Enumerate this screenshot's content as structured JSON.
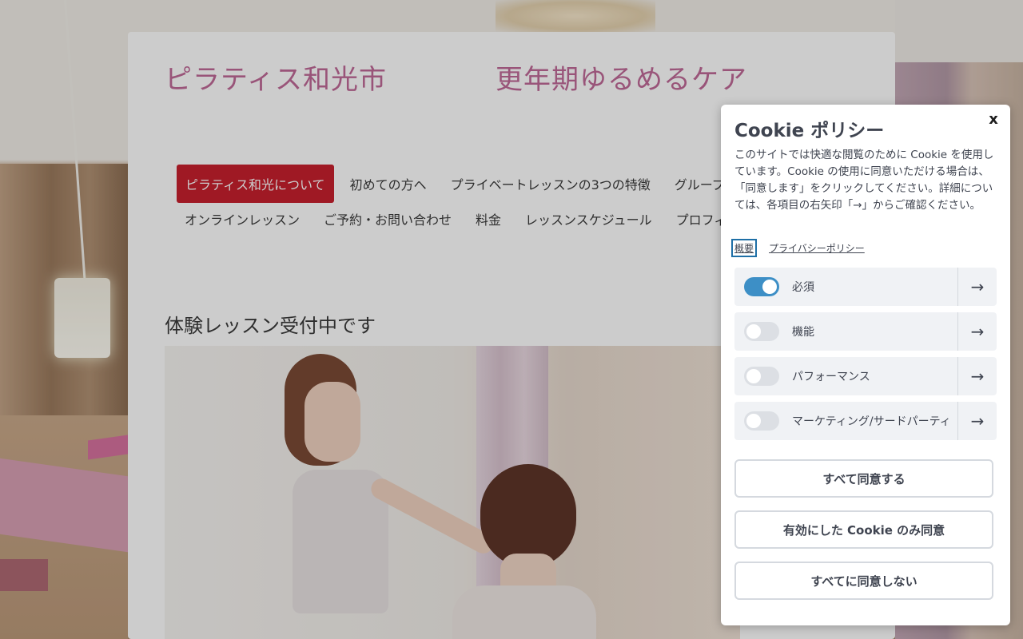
{
  "site": {
    "title": "ピラティス和光市",
    "subtitle": "更年期ゆるめるケア"
  },
  "nav": {
    "row1": [
      "ピラティス和光について",
      "初めての方へ",
      "プライベートレッスンの3つの特徴",
      "グループレ"
    ],
    "row2": [
      "オンラインレッスン",
      "ご予約・お問い合わせ",
      "料金",
      "レッスンスケジュール",
      "プロフィ"
    ],
    "active_index": 0
  },
  "main": {
    "heading": "体験レッスン受付中です"
  },
  "cookie": {
    "close_label": "x",
    "title": "Cookie ポリシー",
    "description": "このサイトでは快適な閲覧のために Cookie を使用しています。Cookie の使用に同意いただける場合は、「同意します」をクリックしてください。詳細については、各項目の右矢印「→」からご確認ください。",
    "links": {
      "overview": "概要",
      "privacy": "プライバシーポリシー"
    },
    "categories": [
      {
        "label": "必須",
        "enabled": true
      },
      {
        "label": "機能",
        "enabled": false
      },
      {
        "label": "パフォーマンス",
        "enabled": false
      },
      {
        "label": "マーケティング/サードパーティ",
        "enabled": false
      }
    ],
    "arrow_icon": "arrow-right-icon",
    "buttons": {
      "accept_all": "すべて同意する",
      "accept_selected": "有効にした Cookie のみ同意",
      "reject_all": "すべてに同意しない"
    }
  },
  "colors": {
    "site_title": "#c06a98",
    "nav_active_bg": "#c7202e",
    "toggle_on": "#3d8fc6"
  }
}
